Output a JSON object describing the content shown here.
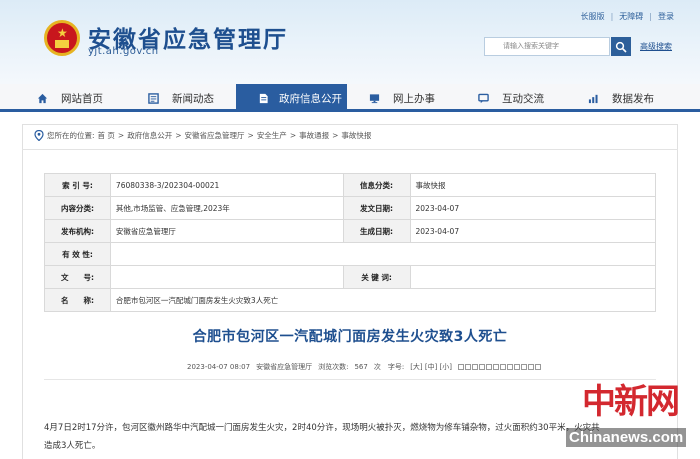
{
  "header": {
    "site_title": "安徽省应急管理厅",
    "domain": "yjt.ah.gov.cn",
    "top_links": [
      "长服版",
      "无障碍",
      "登录"
    ],
    "search_placeholder": "请输入搜索关键字",
    "advanced_search": "高级搜索"
  },
  "nav": {
    "items": [
      {
        "label": "网站首页",
        "icon": "home-icon"
      },
      {
        "label": "新闻动态",
        "icon": "news-icon"
      },
      {
        "label": "政府信息公开",
        "icon": "document-icon",
        "active": true
      },
      {
        "label": "网上办事",
        "icon": "monitor-icon"
      },
      {
        "label": "互动交流",
        "icon": "chat-icon"
      },
      {
        "label": "数据发布",
        "icon": "chart-icon"
      }
    ],
    "accent": "#2a5da0"
  },
  "breadcrumb": {
    "label": "您所在的位置:",
    "items": [
      "首 页",
      "政府信息公开",
      "安徽省应急管理厅",
      "安全生产",
      "事故通报",
      "事故快报"
    ]
  },
  "meta": {
    "index_label": "索 引 号:",
    "index_value": "76080338-3/202304-00021",
    "info_cat_label": "信息分类:",
    "info_cat_value": "事故快报",
    "content_label": "内容分类:",
    "content_value": "其他,市场监管、应急管理,2023年",
    "publish_date_label": "发文日期:",
    "publish_date_value": "2023-04-07",
    "org_label": "发布机构:",
    "org_value": "安徽省应急管理厅",
    "gen_date_label": "生成日期:",
    "gen_date_value": "2023-04-07",
    "validity_label": "有 效 性:",
    "validity_value": "",
    "doc_no_label": "文　　号:",
    "doc_no_value": "",
    "keywords_label": "关 键 词:",
    "keywords_value": "",
    "name_label": "名　　称:",
    "name_value": "合肥市包河区一汽配城门面房发生火灾致3人死亡"
  },
  "article": {
    "title": "合肥市包河区一汽配城门面房发生火灾致3人死亡",
    "date": "2023-04-07 08:07",
    "source": "安徽省应急管理厅",
    "views_label": "浏览次数:",
    "views": "567",
    "size_label": "次　字号:",
    "size_options": "[大] [中] [小]",
    "body_line1": "4月7日2时17分许，包河区徽州路华中汽配城一门面房发生火灾，2时40分许，现场明火被扑灭，燃烧物为修车铺杂物，过火面积约30平米，火灾共",
    "body_line2": "造成3人死亡。"
  },
  "watermark": {
    "cn": "中新网",
    "en": "Chinanews.com"
  }
}
